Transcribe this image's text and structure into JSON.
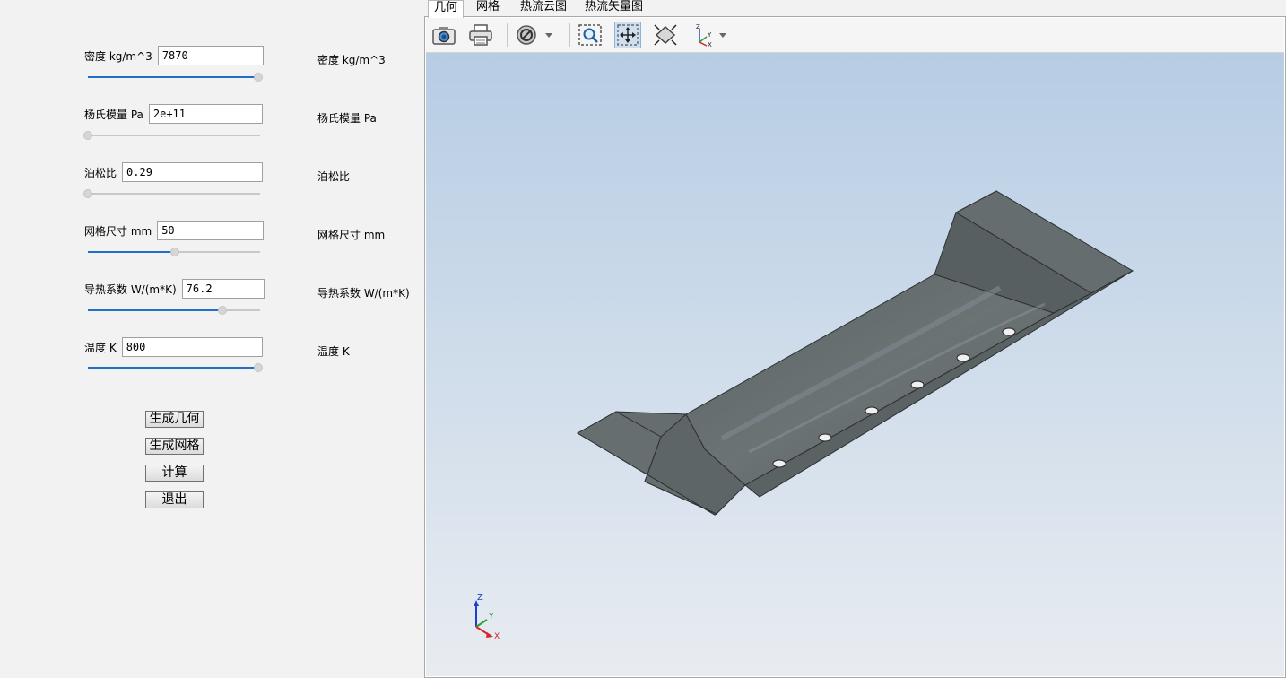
{
  "params": [
    {
      "label": "密度 kg/m^3",
      "value": "7870",
      "slider": 1.0,
      "echo": "密度 kg/m^3"
    },
    {
      "label": "杨氏模量 Pa",
      "value": "2e+11",
      "slider": 0.0,
      "echo": "杨氏模量 Pa"
    },
    {
      "label": "泊松比",
      "value": "0.29",
      "slider": 0.0,
      "echo": "泊松比"
    },
    {
      "label": "网格尺寸 mm",
      "value": "50",
      "slider": 0.51,
      "echo": "网格尺寸 mm"
    },
    {
      "label": "导热系数 W/(m*K)",
      "value": "76.2",
      "slider": 0.79,
      "echo": "导热系数 W/(m*K)"
    },
    {
      "label": "温度 K",
      "value": "800",
      "slider": 1.0,
      "echo": "温度 K"
    }
  ],
  "buttons": {
    "generate_geometry": "生成几何",
    "generate_mesh": "生成网格",
    "compute": "计算",
    "exit": "退出"
  },
  "tabs": [
    "几何",
    "网格",
    "热流云图",
    "热流矢量图"
  ],
  "active_tab": 0,
  "toolbar_icons": [
    "camera-icon",
    "print-icon",
    "display-mode-icon",
    "zoom-box-icon",
    "pan-icon",
    "fit-all-icon",
    "axes-orientation-icon"
  ],
  "axis_triad": {
    "z": "Z",
    "y": "Y",
    "x": "X"
  },
  "colors": {
    "accent": "#1f6fc6",
    "background_top": "#b7cde4",
    "background_bottom": "#e8ecf1",
    "model": "#5f6668"
  }
}
